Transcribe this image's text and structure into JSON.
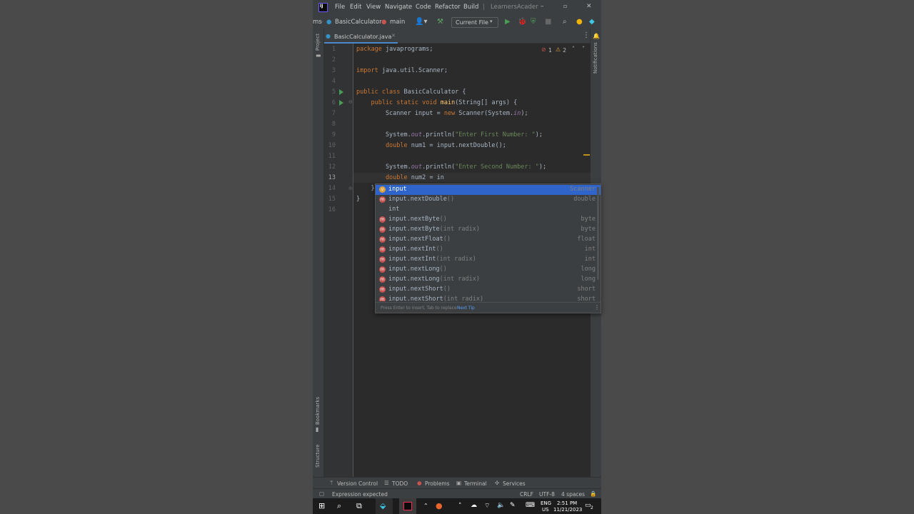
{
  "menu": {
    "items": [
      "File",
      "Edit",
      "View",
      "Navigate",
      "Code",
      "Refactor",
      "Build"
    ],
    "project_title": "LearnersAcader"
  },
  "nav": {
    "prefix": "ms",
    "file_crumb": "BasicCalculator",
    "method_crumb": "main",
    "run_config": "Current File"
  },
  "tabs": [
    {
      "label": "BasicCalculator.java",
      "active": true
    }
  ],
  "side": {
    "left_top": "Project",
    "left_bookmarks": "Bookmarks",
    "left_structure": "Structure",
    "right": "Notifications"
  },
  "inspection": {
    "errors": "1",
    "warnings": "2"
  },
  "editor": {
    "line_numbers": [
      "1",
      "2",
      "3",
      "4",
      "5",
      "6",
      "7",
      "8",
      "9",
      "10",
      "11",
      "12",
      "13",
      "14",
      "15",
      "16"
    ],
    "lines": {
      "l1_kw": "package",
      "l1_rest": " javaprograms;",
      "l3_kw": "import",
      "l3_rest": " java.util.Scanner;",
      "l5_kw": "public class",
      "l5_rest": " BasicCalculator {",
      "l6_kw": "    public static void",
      "l6_fn": " main",
      "l6_rest": "(String[] args) {",
      "l7_a": "        Scanner input = ",
      "l7_kw": "new",
      "l7_b": " Scanner(System.",
      "l7_fld": "in",
      "l7_c": ");",
      "l9_a": "        System.",
      "l9_fld": "out",
      "l9_b": ".println(",
      "l9_st": "\"Enter First Number: \"",
      "l9_c": ");",
      "l10_kw": "        double",
      "l10_rest": " num1 = input.nextDouble();",
      "l12_a": "        System.",
      "l12_fld": "out",
      "l12_b": ".println(",
      "l12_st": "\"Enter Second Number: \"",
      "l12_c": ");",
      "l13_kw": "        double",
      "l13_rest": " num2 = in",
      "l14": "    }",
      "l15": "}"
    }
  },
  "completion": {
    "items": [
      {
        "icon": "v",
        "name": "input",
        "params": "",
        "type": "Scanner"
      },
      {
        "icon": "m",
        "name": "input.nextDouble",
        "params": "()",
        "type": "double"
      },
      {
        "icon": "",
        "name": "int",
        "params": "",
        "type": ""
      },
      {
        "icon": "m",
        "name": "input.nextByte",
        "params": "()",
        "type": "byte"
      },
      {
        "icon": "m",
        "name": "input.nextByte",
        "params": "(int radix)",
        "type": "byte"
      },
      {
        "icon": "m",
        "name": "input.nextFloat",
        "params": "()",
        "type": "float"
      },
      {
        "icon": "m",
        "name": "input.nextInt",
        "params": "()",
        "type": "int"
      },
      {
        "icon": "m",
        "name": "input.nextInt",
        "params": "(int radix)",
        "type": "int"
      },
      {
        "icon": "m",
        "name": "input.nextLong",
        "params": "()",
        "type": "long"
      },
      {
        "icon": "m",
        "name": "input.nextLong",
        "params": "(int radix)",
        "type": "long"
      },
      {
        "icon": "m",
        "name": "input.nextShort",
        "params": "()",
        "type": "short"
      },
      {
        "icon": "m",
        "name": "input.nextShort",
        "params": "(int radix)",
        "type": "short"
      }
    ],
    "hint": "Press Enter to insert, Tab to replace",
    "next_tip": "Next Tip"
  },
  "toolwindows": [
    "Version Control",
    "TODO",
    "Problems",
    "Terminal",
    "Services"
  ],
  "status": {
    "message": "Expression expected",
    "line_sep": "CRLF",
    "encoding": "UTF-8",
    "indent": "4 spaces"
  },
  "taskbar": {
    "lang": "ENG",
    "region": "US",
    "time": "2:51 PM",
    "date": "11/21/2023",
    "notif_count": "2"
  },
  "colors": {
    "editor_bg": "#2b2b2b",
    "keyword": "#cc7832",
    "string": "#6a8759",
    "function": "#ffc66d",
    "field": "#9876aa",
    "accent": "#4a88c7"
  }
}
